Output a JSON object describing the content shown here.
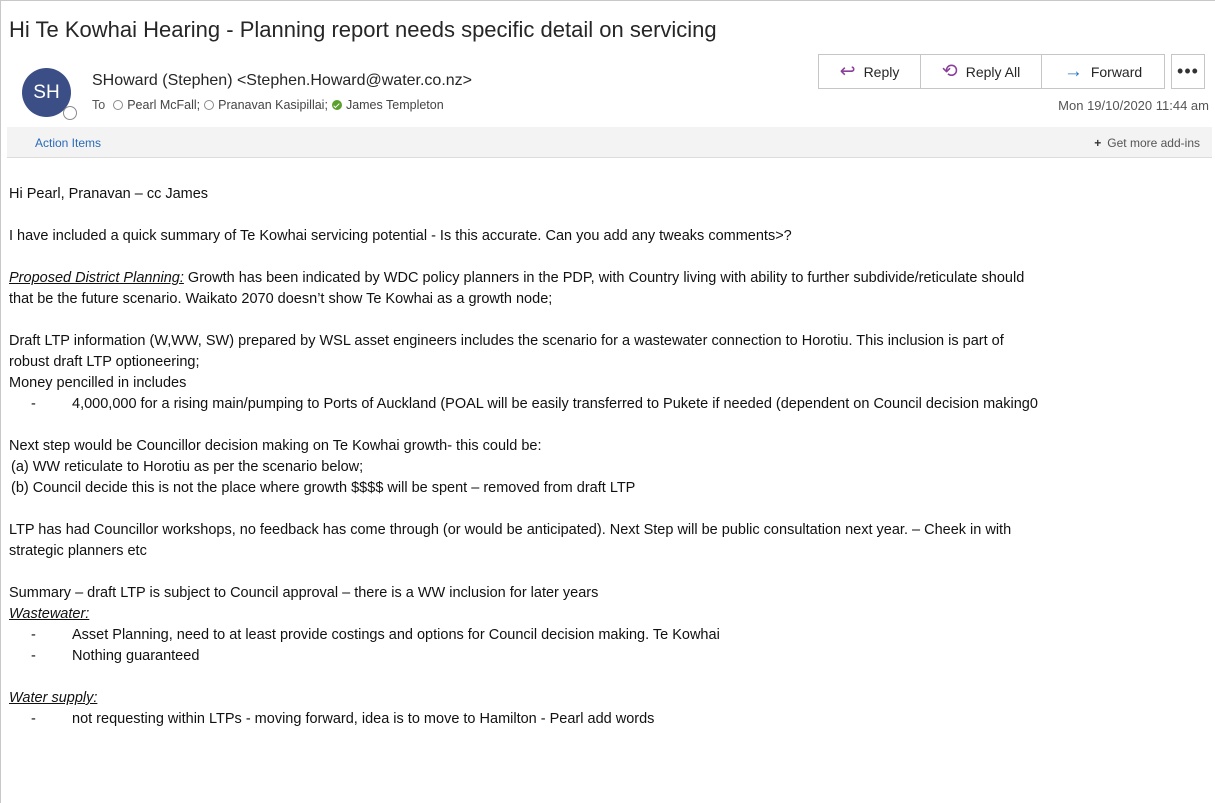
{
  "email": {
    "subject": "Hi  Te Kowhai Hearing  - Planning report needs specific detail on servicing",
    "avatar_initials": "SH",
    "sender": "SHoward (Stephen) <Stephen.Howard@water.co.nz>",
    "to_label": "To",
    "recipients": [
      {
        "name": "Pearl McFall;",
        "presence": "offline"
      },
      {
        "name": "Pranavan Kasipillai;",
        "presence": "offline"
      },
      {
        "name": "James Templeton",
        "presence": "available"
      }
    ],
    "date": "Mon 19/10/2020 11:44 am"
  },
  "toolbar": {
    "reply_label": "Reply",
    "reply_all_label": "Reply All",
    "forward_label": "Forward",
    "more_label": "•••"
  },
  "actions_bar": {
    "action_items": "Action Items",
    "get_addins": "Get more add-ins"
  },
  "body": {
    "greeting": "Hi Pearl, Pranavan – cc James",
    "intro": "I have included a quick summary of Te Kowhai servicing potential  - Is this accurate. Can you  add any tweaks comments>?",
    "pdp_heading": "Proposed District Planning:",
    "pdp_line1": " Growth has been indicated by WDC policy planners in the PDP, with Country living with ability to further subdivide/reticulate should",
    "pdp_line2": "that be the future scenario.  Waikato 2070 doesn’t show Te Kowhai as a growth node;",
    "ltp_line1": "Draft LTP information (W,WW, SW) prepared by WSL asset engineers includes the scenario for a wastewater connection to Horotiu. This inclusion is part of",
    "ltp_line2": "robust draft LTP optioneering;",
    "money_line": "Money pencilled in includes",
    "money_bullet": "4,000,000 for a rising main/pumping to Ports of Auckland  (POAL will be easily transferred to Pukete if needed (dependent on Council decision making0",
    "next_step": "Next step would be Councillor decision making on Te Kowhai growth- this could be:",
    "option_a": "(a)  WW reticulate to Horotiu as per the scenario below;",
    "option_b": "(b)  Council decide this is not the place where growth $$$$ will be spent – removed from draft LTP",
    "workshop_line1": "LTP has had Councillor workshops, no feedback has come through (or would be anticipated). Next Step will be public consultation next year. – Cheek in with",
    "workshop_line2": "strategic planners etc",
    "summary": "Summary – draft LTP is subject to Council approval – there is a WW inclusion for later years",
    "wastewater_heading": "Wastewater:",
    "wastewater_bullets": [
      "Asset Planning, need to at least provide costings and options for Council decision making. Te Kowhai",
      "Nothing guaranteed"
    ],
    "water_heading": "Water supply:",
    "water_bullets": [
      "not requesting within LTPs  - moving forward, idea is to move to Hamilton  - Pearl add words"
    ],
    "bullet_dash": "-"
  },
  "colors": {
    "avatar_bg": "#3b4f86",
    "reply_icon": "#8a3f9a",
    "forward_icon": "#2a74c7",
    "link": "#2a6bb8",
    "presence_available": "#5aa02c"
  },
  "icons": {
    "reply": "reply-arrow-icon",
    "reply_all": "reply-all-arrow-icon",
    "forward": "forward-arrow-icon",
    "more": "ellipsis-icon",
    "add": "plus-icon"
  }
}
